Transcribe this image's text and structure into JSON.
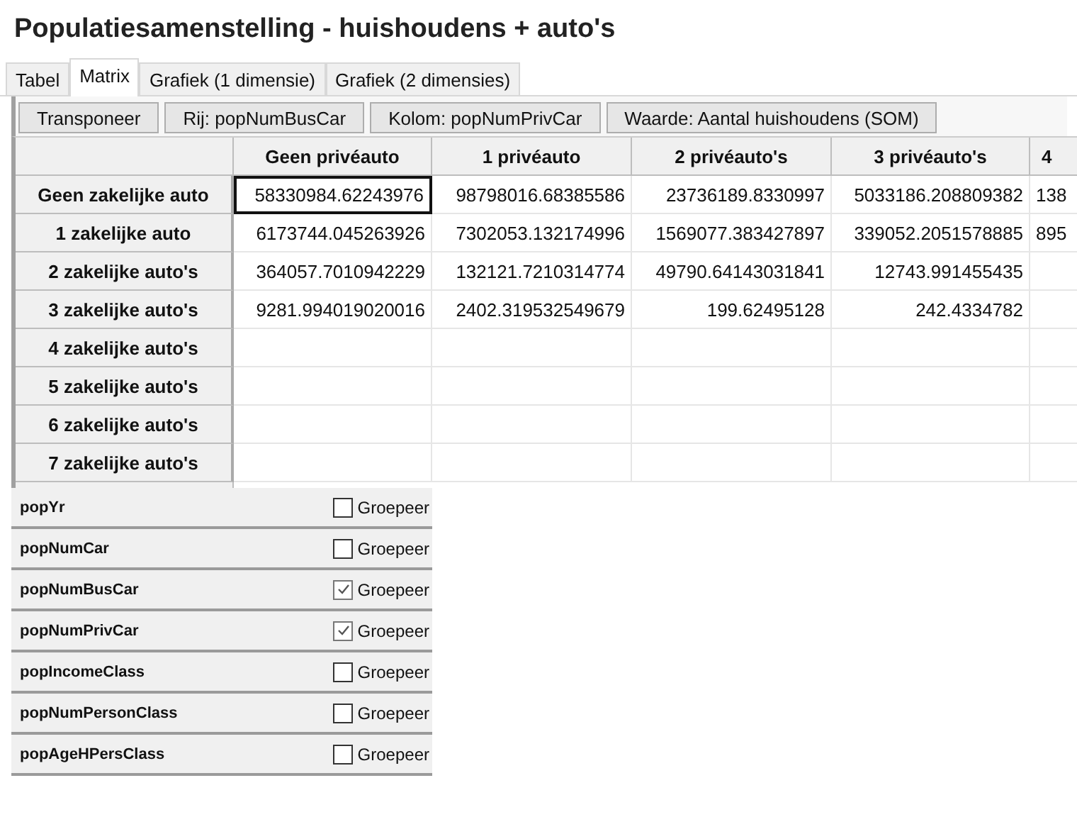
{
  "window": {
    "title": "Populatiesamenstelling - huishoudens + auto's"
  },
  "tabs": [
    {
      "label": "Tabel",
      "selected": false
    },
    {
      "label": "Matrix",
      "selected": true
    },
    {
      "label": "Grafiek (1 dimensie)",
      "selected": false
    },
    {
      "label": "Grafiek (2 dimensies)",
      "selected": false
    }
  ],
  "toolbar": [
    "Transponeer",
    "Rij: popNumBusCar",
    "Kolom: popNumPrivCar",
    "Waarde: Aantal huishoudens (SOM)"
  ],
  "matrix": {
    "columns": [
      "Geen privéauto",
      "1 privéauto",
      "2 privéauto's",
      "3 privéauto's",
      "4"
    ],
    "rows": [
      {
        "label": "Geen zakelijke auto",
        "cells": [
          {
            "text": "58330984.62243976",
            "selected": true
          },
          {
            "text": "98798016.68385586",
            "selected": false
          },
          {
            "text": "23736189.8330997",
            "selected": false
          },
          {
            "text": "5033186.208809382",
            "selected": false
          },
          {
            "text": "138",
            "selected": false
          }
        ]
      },
      {
        "label": "1 zakelijke auto",
        "cells": [
          {
            "text": "6173744.045263926",
            "selected": false
          },
          {
            "text": "7302053.132174996",
            "selected": false
          },
          {
            "text": "1569077.383427897",
            "selected": false
          },
          {
            "text": "339052.2051578885",
            "selected": false
          },
          {
            "text": "895",
            "selected": false
          }
        ]
      },
      {
        "label": "2 zakelijke auto's",
        "cells": [
          {
            "text": "364057.7010942229",
            "selected": false
          },
          {
            "text": "132121.7210314774",
            "selected": false
          },
          {
            "text": "49790.64143031841",
            "selected": false
          },
          {
            "text": "12743.991455435",
            "selected": false
          }
        ]
      },
      {
        "label": "3 zakelijke auto's",
        "cells": [
          {
            "text": "9281.994019020016",
            "selected": false
          },
          {
            "text": "2402.319532549679",
            "selected": false
          },
          {
            "text": "199.62495128",
            "selected": false
          },
          {
            "text": "242.4334782",
            "selected": false
          }
        ]
      },
      {
        "label": "4 zakelijke auto's"
      },
      {
        "label": "5 zakelijke auto's"
      },
      {
        "label": "6 zakelijke auto's"
      },
      {
        "label": "7 zakelijke auto's"
      }
    ]
  },
  "fields": [
    {
      "name": "popYr",
      "group_label": "Groepeer",
      "checked": false
    },
    {
      "name": "popNumCar",
      "group_label": "Groepeer",
      "checked": false
    },
    {
      "name": "popNumBusCar",
      "group_label": "Groepeer",
      "checked": true
    },
    {
      "name": "popNumPrivCar",
      "group_label": "Groepeer",
      "checked": true
    },
    {
      "name": "popIncomeClass",
      "group_label": "Groepeer",
      "checked": false
    },
    {
      "name": "popNumPersonClass",
      "group_label": "Groepeer",
      "checked": false
    },
    {
      "name": "popAgeHPersClass",
      "group_label": "Groepeer",
      "checked": false
    }
  ]
}
